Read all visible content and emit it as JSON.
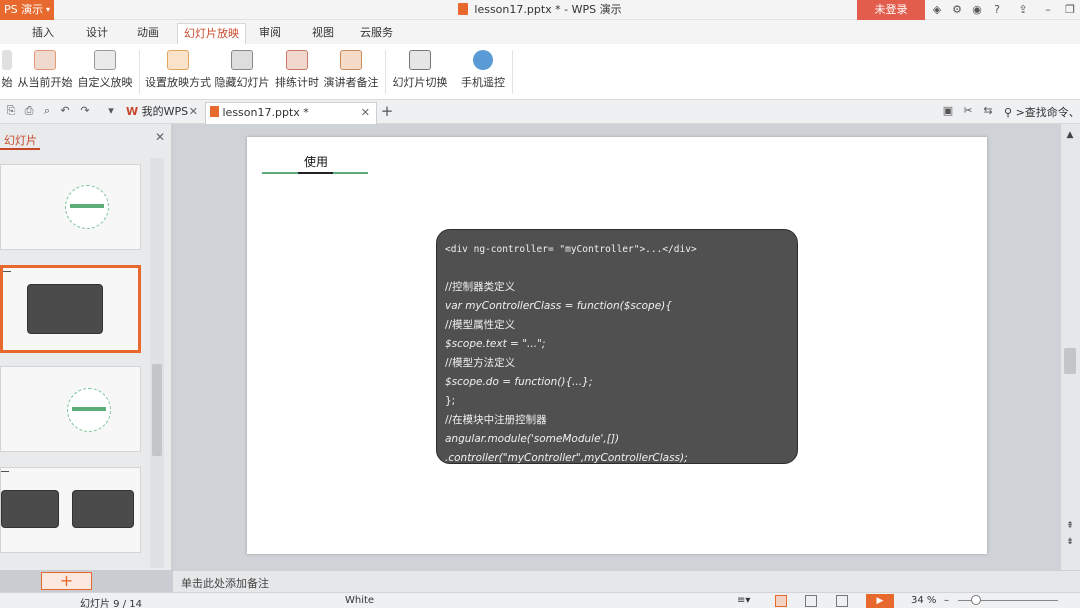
{
  "app": {
    "badge": "PS 演示",
    "title": "lesson17.pptx * - WPS 演示",
    "login": "未登录"
  },
  "ribbon_tabs": [
    "插入",
    "设计",
    "动画",
    "幻灯片放映",
    "审阅",
    "视图",
    "云服务"
  ],
  "active_tab": "幻灯片放映",
  "ribbon_buttons": [
    "始",
    "从当前开始",
    "自定义放映",
    "设置放映方式",
    "隐藏幻灯片",
    "排练计时",
    "演讲者备注",
    "幻灯片切换",
    "手机遥控"
  ],
  "doc_tabs": [
    {
      "label": "我的WPS"
    },
    {
      "label": "lesson17.pptx *"
    }
  ],
  "search_placeholder": ">查找命令、",
  "panel": {
    "title": "幻灯片"
  },
  "slide": {
    "title": "使用",
    "code": [
      "<div ng-controller= \"myController\">...</div>",
      "",
      "//控制器类定义",
      "var myControllerClass = function($scope){",
      "//模型属性定义",
      "$scope.text = \"...\";",
      "//模型方法定义",
      "$scope.do = function(){...};",
      "};",
      "//在模块中注册控制器",
      "angular.module('someModule',[])",
      ".controller(\"myController\",myControllerClass);"
    ]
  },
  "notes_placeholder": "单击此处添加备注",
  "status": {
    "slide_count": "幻灯片 9 / 14",
    "theme": "White",
    "zoom": "34 %"
  },
  "colors": {
    "accent": "#e8692e",
    "login": "#e35d4d",
    "code_bg": "#505050",
    "slide_line": "#5daa7a"
  }
}
